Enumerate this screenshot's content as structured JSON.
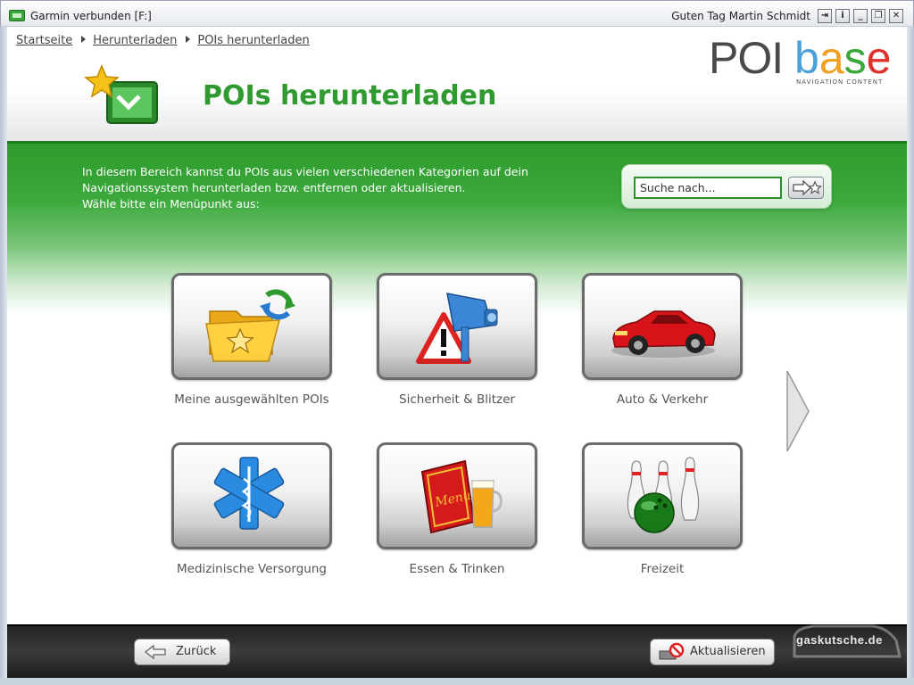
{
  "window": {
    "title": "Garmin verbunden [F:]",
    "greeting": "Guten Tag Martin Schmidt",
    "controls": [
      "⇥",
      "i",
      "_",
      "❐",
      "✕"
    ]
  },
  "breadcrumb": [
    "Startseite",
    "Herunterladen",
    "POIs herunterladen"
  ],
  "page": {
    "title": "POIs herunterladen"
  },
  "logo": {
    "poi": "POI",
    "base_letters": [
      "b",
      "a",
      "s",
      "e"
    ],
    "tagline": "NAVIGATION CONTENT"
  },
  "intro": [
    "In diesem Bereich kannst du POIs aus vielen verschiedenen Kategorien auf dein",
    "Navigationssystem herunterladen bzw. entfernen oder aktualisieren.",
    "Wähle bitte ein Menüpunkt aus:"
  ],
  "search": {
    "value": "Suche nach..."
  },
  "tiles": [
    {
      "label": "Meine ausgewählten POIs",
      "icon": "folder-star-icon"
    },
    {
      "label": "Sicherheit & Blitzer",
      "icon": "speed-camera-icon"
    },
    {
      "label": "Auto & Verkehr",
      "icon": "car-icon"
    },
    {
      "label": "Medizinische Versorgung",
      "icon": "medical-star-icon"
    },
    {
      "label": "Essen & Trinken",
      "icon": "menu-beer-icon"
    },
    {
      "label": "Freizeit",
      "icon": "bowling-icon"
    }
  ],
  "footer": {
    "back": "Zurück",
    "update": "Aktualisieren",
    "watermark": "gaskutsche.de"
  },
  "colors": {
    "accent": "#2f9a2f",
    "logo_b": "#4aa0d8",
    "logo_a": "#f0a020",
    "logo_s": "#39a83a",
    "logo_e": "#e0302a"
  }
}
